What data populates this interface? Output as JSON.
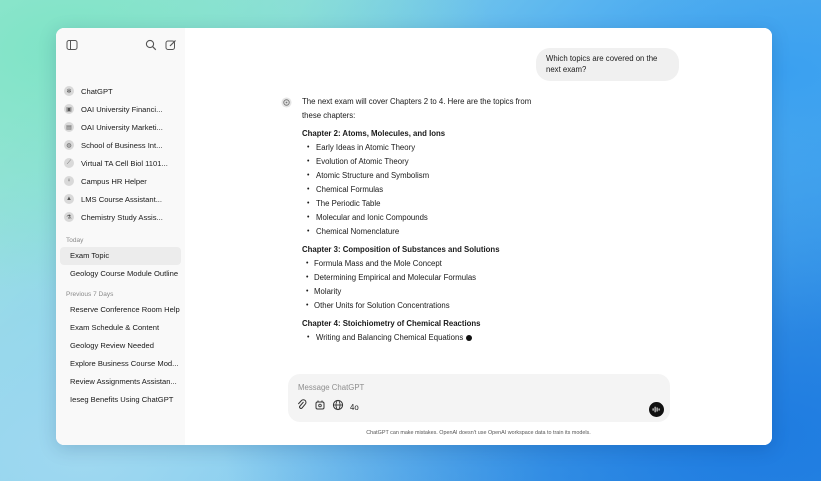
{
  "sidebar": {
    "icons": {
      "toggle": "sidebar-toggle-icon",
      "search": "search-icon",
      "new_chat": "new-chat-icon"
    },
    "gpts": [
      {
        "label": "ChatGPT",
        "icon": "chatgpt-logo-icon"
      },
      {
        "label": "OAI University Financi...",
        "icon": "gpt-avatar-icon"
      },
      {
        "label": "OAI University Marketi...",
        "icon": "gpt-avatar-icon"
      },
      {
        "label": "School of Business Int...",
        "icon": "gpt-avatar-icon"
      },
      {
        "label": "Virtual TA Cell Biol 1101...",
        "icon": "gpt-avatar-icon"
      },
      {
        "label": "Campus HR Helper",
        "icon": "gpt-avatar-icon"
      },
      {
        "label": "LMS Course Assistant...",
        "icon": "gpt-avatar-icon"
      },
      {
        "label": "Chemistry Study Assis...",
        "icon": "gpt-avatar-icon"
      }
    ],
    "today_label": "Today",
    "today": [
      "Exam Topic",
      "Geology Course Module Outline"
    ],
    "prev7_label": "Previous 7 Days",
    "prev7": [
      "Reserve Conference Room Help",
      "Exam Schedule & Content",
      "Geology Review Needed",
      "Explore Business Course Mod...",
      "Review Assignments Assistan...",
      "Ieseg Benefits Using ChatGPT"
    ]
  },
  "conversation": {
    "user_message": "Which topics are covered on the next exam?",
    "intro": "The next exam will cover Chapters 2 to 4. Here are the topics from these chapters:",
    "chapters": [
      {
        "title": "Chapter 2: Atoms, Molecules, and Ions",
        "topics": [
          "Early Ideas in Atomic Theory",
          "Evolution of Atomic Theory",
          "Atomic Structure and Symbolism",
          "Chemical Formulas",
          "The Periodic Table",
          "Molecular and Ionic Compounds",
          "Chemical Nomenclature"
        ]
      },
      {
        "title": "Chapter 3: Composition of Substances and Solutions",
        "topics": [
          "Formula Mass and the Mole Concept",
          "Determining Empirical and Molecular Formulas",
          "Molarity",
          "Other Units for Solution Concentrations"
        ]
      },
      {
        "title": "Chapter 4: Stoichiometry of Chemical Reactions",
        "topics": [
          "Writing and Balancing Chemical Equations"
        ]
      }
    ]
  },
  "composer": {
    "placeholder": "Message ChatGPT",
    "model": "4o",
    "icons": [
      "attach-icon",
      "tools-icon",
      "globe-icon",
      "voice-icon"
    ]
  },
  "footnote": "ChatGPT can make mistakes. OpenAI doesn't use OpenAI workspace data to train its models."
}
